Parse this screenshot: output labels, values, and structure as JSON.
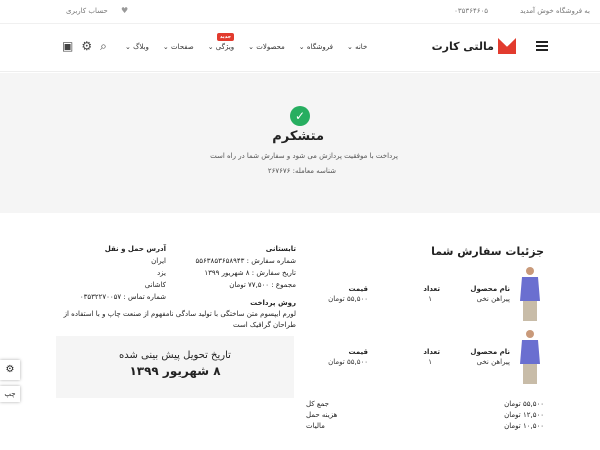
{
  "topbar": {
    "welcome": "به فروشگاه خوش آمدید",
    "phone": "۰۳۵۳۶۴۶۰۵",
    "account": "حساب کاربری"
  },
  "header": {
    "logo_text": "مالتی کارت",
    "nav": [
      {
        "label": "خانه"
      },
      {
        "label": "فروشگاه"
      },
      {
        "label": "محصولات"
      },
      {
        "label": "ویژگی",
        "badge": "جدید"
      },
      {
        "label": "صفحات"
      },
      {
        "label": "وبلاگ"
      }
    ]
  },
  "hero": {
    "title": "متشکرم",
    "message": "پرداخت با موفقیت پردازش می شود و سفارش شما در راه است",
    "transaction": "شناسه معامله: ۲۶۷۶۷۶"
  },
  "order": {
    "title": "جزئیات سفارش شما",
    "headers": {
      "name": "نام محصول",
      "qty": "تعداد",
      "price": "قیمت"
    },
    "products": [
      {
        "name": "پیراهن نخی",
        "qty": "۱",
        "price": "۵۵,۵۰۰ تومان"
      },
      {
        "name": "پیراهن نخی",
        "qty": "۱",
        "price": "۵۵,۵۰۰ تومان"
      }
    ],
    "summary": [
      {
        "label": "جمع کل",
        "value": "۵۵,۵۰۰ تومان"
      },
      {
        "label": "هزینه حمل",
        "value": "۱۲,۵۰۰ تومان"
      },
      {
        "label": "مالیات",
        "value": "۱۰,۵۰۰ تومان"
      }
    ]
  },
  "info": {
    "title": "تابستانی",
    "order_no": "شماره سفارش : ۵۵۶۳۸۵۳۶۵۸۹۴۳",
    "date": "تاریخ سفارش : ۸ شهریور ۱۳۹۹",
    "total": "مجموع : ۷۷,۵۰۰ تومان"
  },
  "address": {
    "title": "آدرس حمل و نقل",
    "l1": "ایران",
    "l2": "یزد",
    "l3": "کاشانی",
    "phone": "شماره تماس : ۰۳۵۳۲۲۷۰۰۵۷"
  },
  "payment": {
    "title": "روش پرداخت",
    "text": "لورم ایپسوم متن ساختگی با تولید سادگی نامفهوم از صنعت چاپ و با استفاده از طراحان گرافیک است"
  },
  "delivery": {
    "label": "تاریخ تحویل پیش بینی شده",
    "date": "۸ شهریور ۱۳۹۹"
  },
  "side": {
    "rtl": "چپ"
  }
}
